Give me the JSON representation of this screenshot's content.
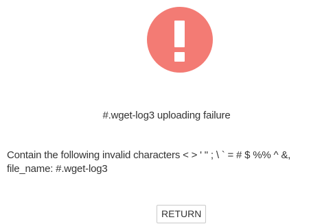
{
  "dialog": {
    "icon": "exclamation-icon",
    "icon_color": "#f37b74",
    "title": "#.wget-log3 uploading failure",
    "message_line1": "Contain the following invalid characters < > ' \" ; \\ ` = # $ %% ^ &,",
    "message_line2": "file_name: #.wget-log3",
    "return_label": "RETURN"
  }
}
